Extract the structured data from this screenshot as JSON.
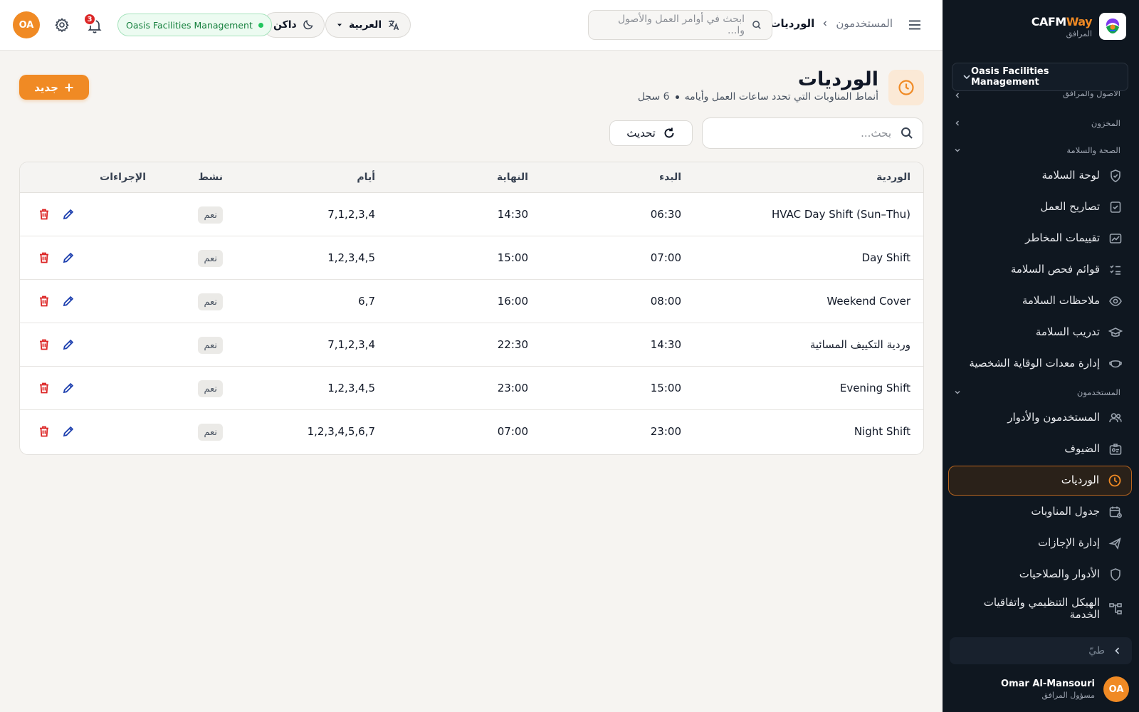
{
  "sidebar": {
    "brand_name_a": "CAFM",
    "brand_name_b": "Way",
    "brand_sub": "المرافق",
    "org_select": "Oasis Facilities Management",
    "section_assets": "الأصول والمرافق",
    "section_inventory": "المخزون",
    "section_safety": "الصحة والسلامة",
    "section_users": "المستخدمون",
    "items": [
      {
        "label": "لوحة السلامة",
        "icon": "shield-check-icon"
      },
      {
        "label": "تصاريح العمل",
        "icon": "clipboard-check-icon"
      },
      {
        "label": "تقييمات المخاطر",
        "icon": "chart-icon"
      },
      {
        "label": "قوائم فحص السلامة",
        "icon": "checklist-icon"
      },
      {
        "label": "ملاحظات السلامة",
        "icon": "eye-icon"
      },
      {
        "label": "تدريب السلامة",
        "icon": "graduation-cap-icon"
      },
      {
        "label": "إدارة معدات الوقاية الشخصية",
        "icon": "mask-icon"
      },
      {
        "label": "المستخدمون والأدوار",
        "icon": "users-icon"
      },
      {
        "label": "الضيوف",
        "icon": "id-card-icon"
      },
      {
        "label": "الورديات",
        "icon": "clock-icon"
      },
      {
        "label": "جدول المناوبات",
        "icon": "calendar-icon"
      },
      {
        "label": "إدارة الإجازات",
        "icon": "plane-icon"
      },
      {
        "label": "الأدوار والصلاحيات",
        "icon": "shield-icon"
      },
      {
        "label": "الهيكل التنظيمي واتفاقيات الخدمة",
        "icon": "org-chart-icon"
      }
    ],
    "collapse_label": "طيّ",
    "user_name": "Omar Al-Mansouri",
    "user_role": "مسؤول المرافق",
    "user_initials": "OA"
  },
  "topbar": {
    "breadcrumb_parent": "المستخدمون",
    "breadcrumb_current": "الورديات",
    "search_placeholder": "ابحث في أوامر العمل والأصول وا...",
    "language": "العربية",
    "theme": "داكن",
    "org_pill": "Oasis Facilities Management",
    "notifications_count": "3",
    "avatar_initials": "OA"
  },
  "page": {
    "title": "الورديات",
    "subtitle": "أنماط المناوبات التي تحدد ساعات العمل وأيامه",
    "record_count": "6 سجل",
    "new_button": "جديد",
    "search_placeholder": "بحث...",
    "refresh_button": "تحديث"
  },
  "table": {
    "headers": {
      "shift": "الوردية",
      "start": "البدء",
      "end": "النهاية",
      "days": "أيام",
      "active": "نشط",
      "actions": "الإجراءات"
    },
    "rows": [
      {
        "shift": "HVAC Day Shift (Sun–Thu)",
        "start": "06:30",
        "end": "14:30",
        "days": "7,1,2,3,4",
        "active": "نعم"
      },
      {
        "shift": "Day Shift",
        "start": "07:00",
        "end": "15:00",
        "days": "1,2,3,4,5",
        "active": "نعم"
      },
      {
        "shift": "Weekend Cover",
        "start": "08:00",
        "end": "16:00",
        "days": "6,7",
        "active": "نعم"
      },
      {
        "shift": "وردية التكييف المسائية",
        "start": "14:30",
        "end": "22:30",
        "days": "7,1,2,3,4",
        "active": "نعم"
      },
      {
        "shift": "Evening Shift",
        "start": "15:00",
        "end": "23:00",
        "days": "1,2,3,4,5",
        "active": "نعم"
      },
      {
        "shift": "Night Shift",
        "start": "23:00",
        "end": "07:00",
        "days": "1,2,3,4,5,6,7",
        "active": "نعم"
      }
    ]
  },
  "colors": {
    "accent": "#f08a24",
    "sidebar_bg": "#0f1720",
    "success": "#22c55e",
    "danger": "#dc2626",
    "edit": "#1e40af"
  }
}
